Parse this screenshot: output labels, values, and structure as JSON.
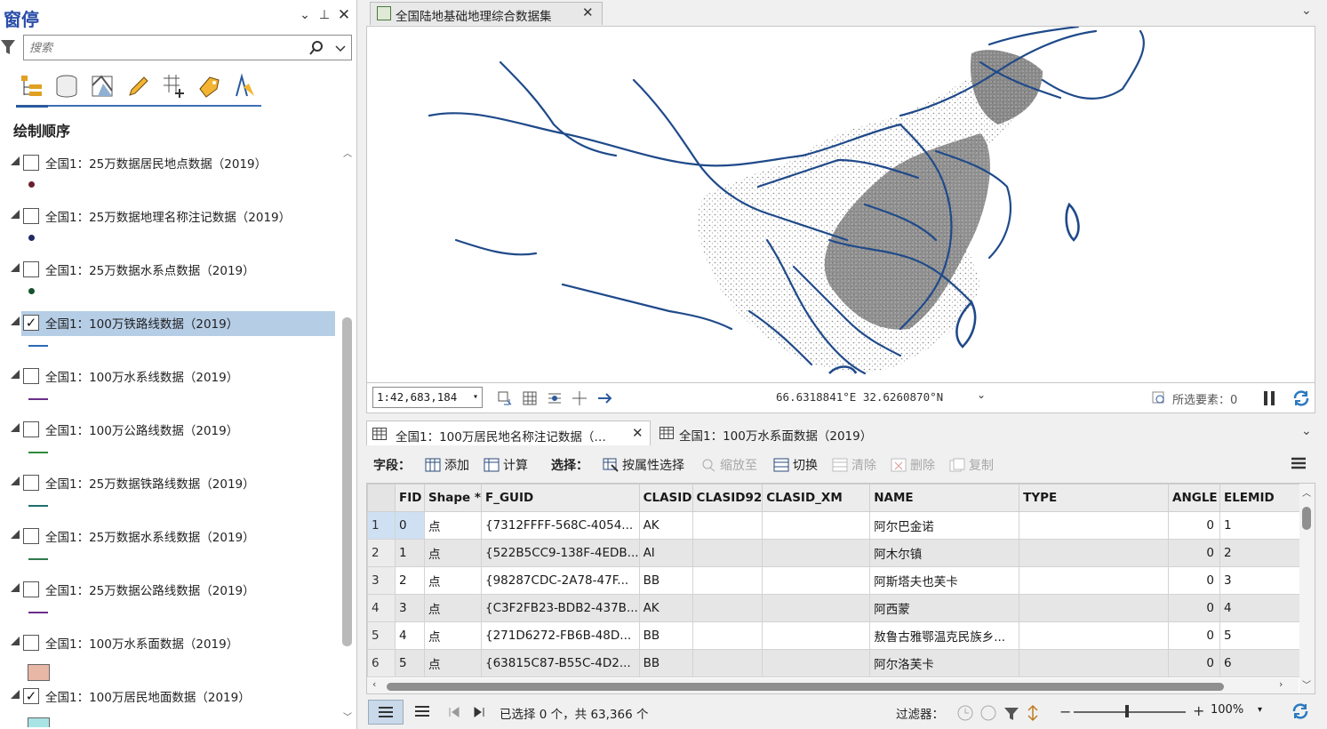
{
  "left_panel": {
    "title": "窗停",
    "search_placeholder": "搜索",
    "section_title": "绘制顺序",
    "layers": [
      {
        "label": "全国1：25万数据居民地点数据（2019）",
        "checked": false,
        "symbol": "dot",
        "color": "#6b1f2e"
      },
      {
        "label": "全国1：25万数据地理名称注记数据（2019）",
        "checked": false,
        "symbol": "dot",
        "color": "#1f2a66"
      },
      {
        "label": "全国1：25万数据水系点数据（2019）",
        "checked": false,
        "symbol": "dot",
        "color": "#14532d"
      },
      {
        "label": "全国1：100万铁路线数据（2019）",
        "checked": true,
        "symbol": "line",
        "color": "#2a6ab5",
        "selected": true
      },
      {
        "label": "全国1：100万水系线数据（2019）",
        "checked": false,
        "symbol": "line",
        "color": "#6a2e8a"
      },
      {
        "label": "全国1：100万公路线数据（2019）",
        "checked": false,
        "symbol": "line",
        "color": "#2f8a3e"
      },
      {
        "label": "全国1：25万数据铁路线数据（2019）",
        "checked": false,
        "symbol": "line",
        "color": "#1f6e6e"
      },
      {
        "label": "全国1：25万数据水系线数据（2019）",
        "checked": false,
        "symbol": "line",
        "color": "#2e7a4e"
      },
      {
        "label": "全国1：25万数据公路线数据（2019）",
        "checked": false,
        "symbol": "line",
        "color": "#6a2e8a"
      },
      {
        "label": "全国1：100万水系面数据（2019）",
        "checked": false,
        "symbol": "rect",
        "color": "#e8b7a6"
      },
      {
        "label": "全国1：100万居民地面数据（2019）",
        "checked": true,
        "symbol": "rect",
        "color": "#a8e4e6"
      }
    ]
  },
  "map": {
    "tab_title": "全国陆地基础地理综合数据集",
    "scale": "1:42,683,184",
    "coords": "66.6318841°E 32.6260870°N",
    "selected_features": "所选要素：0"
  },
  "table": {
    "tab1": "全国1：100万居民地名称注记数据（…",
    "tab2": "全国1：100万水系面数据（2019）",
    "tools": {
      "field_label": "字段：",
      "add": "添加",
      "calculate": "计算",
      "select_label": "选择：",
      "select_by_attr": "按属性选择",
      "zoom_to": "缩放至",
      "switch": "切换",
      "clear": "清除",
      "delete": "删除",
      "copy": "复制"
    },
    "columns": [
      "",
      "FID",
      "Shape *",
      "F_GUID",
      "CLASID",
      "CLASID92",
      "CLASID_XM",
      "NAME",
      "TYPE",
      "ANGLE",
      "ELEMID"
    ],
    "rows": [
      [
        "1",
        "0",
        "点",
        "{7312FFFF-568C-4054...",
        "AK",
        "",
        "",
        "阿尔巴金诺",
        "",
        "0",
        "1"
      ],
      [
        "2",
        "1",
        "点",
        "{522B5CC9-138F-4EDB...",
        "AI",
        "",
        "",
        "阿木尔镇",
        "",
        "0",
        "2"
      ],
      [
        "3",
        "2",
        "点",
        "{98287CDC-2A78-47F...",
        "BB",
        "",
        "",
        "阿斯塔夫也芙卡",
        "",
        "0",
        "3"
      ],
      [
        "4",
        "3",
        "点",
        "{C3F2FB23-BDB2-437B...",
        "AK",
        "",
        "",
        "阿西蒙",
        "",
        "0",
        "4"
      ],
      [
        "5",
        "4",
        "点",
        "{271D6272-FB6B-48D...",
        "BB",
        "",
        "",
        "敖鲁古雅鄂温克民族乡...",
        "",
        "0",
        "5"
      ],
      [
        "6",
        "5",
        "点",
        "{63815C87-B55C-4D2...",
        "BB",
        "",
        "",
        "阿尔洛芙卡",
        "",
        "0",
        "6"
      ]
    ],
    "status": {
      "selection": "已选择 0 个，共 63,366 个",
      "filter_label": "过滤器：",
      "zoom": "100%"
    }
  },
  "colors": {
    "accent": "#2a5a9e",
    "rail": "#1f4a8a",
    "selected_row": "#b6cde6"
  }
}
